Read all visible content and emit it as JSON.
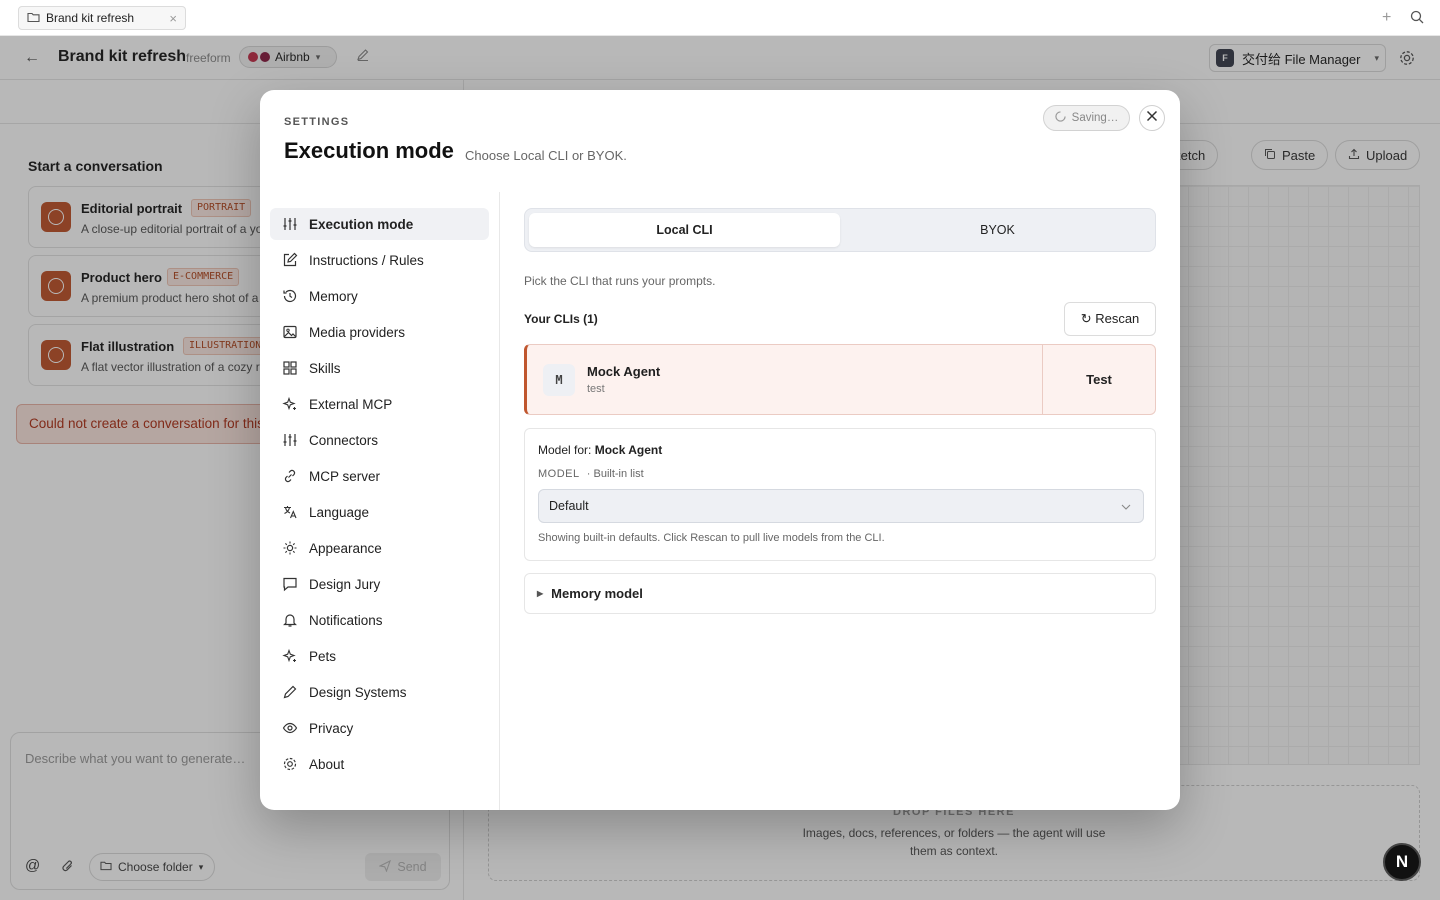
{
  "browser": {
    "tab_title": "Brand kit refresh",
    "tab_close": "×",
    "new_tab": "+"
  },
  "header": {
    "back": "←",
    "title": "Brand kit refresh",
    "mode": "freeform",
    "brand": "Airbnb",
    "brand_colors": [
      "#c2334d",
      "#8b2146"
    ],
    "file_manager_badge": "F",
    "file_manager": "交付给 File Manager"
  },
  "chat": {
    "start_title": "Start a conversation",
    "cards": [
      {
        "title": "Editorial portrait",
        "tag": "PORTRAIT",
        "desc": "A close-up editorial portrait of a young woman in soft window light"
      },
      {
        "title": "Product hero",
        "tag": "E-COMMERCE",
        "desc": "A premium product hero shot of a ceramic mug on a marble surface"
      },
      {
        "title": "Flat illustration",
        "tag": "ILLUSTRATION",
        "desc": "A flat vector illustration of a cozy reading nook with plants"
      }
    ],
    "error": "Could not create a conversation for this project.",
    "composer_placeholder": "Describe what you want to generate…",
    "mention": "@",
    "choose_folder": "Choose folder",
    "send": "Send"
  },
  "canvas": {
    "buttons": {
      "sketch": "New sketch",
      "paste": "Paste",
      "upload": "Upload"
    },
    "drop_title": "DROP FILES HERE",
    "drop_text": "Images, docs, references, or folders — the agent will use them as context.",
    "fab": "N"
  },
  "settings": {
    "kicker": "SETTINGS",
    "title": "Execution mode",
    "subtitle": "Choose Local CLI or BYOK.",
    "saving": "Saving…",
    "nav": [
      {
        "label": "Execution mode",
        "icon": "sliders-icon"
      },
      {
        "label": "Instructions / Rules",
        "icon": "pencil-square-icon"
      },
      {
        "label": "Memory",
        "icon": "history-icon"
      },
      {
        "label": "Media providers",
        "icon": "image-icon"
      },
      {
        "label": "Skills",
        "icon": "grid-icon"
      },
      {
        "label": "External MCP",
        "icon": "sparkle-icon"
      },
      {
        "label": "Connectors",
        "icon": "sliders-icon"
      },
      {
        "label": "MCP server",
        "icon": "link-icon"
      },
      {
        "label": "Language",
        "icon": "translate-icon"
      },
      {
        "label": "Appearance",
        "icon": "sun-icon"
      },
      {
        "label": "Design Jury",
        "icon": "chat-icon"
      },
      {
        "label": "Notifications",
        "icon": "bell-icon"
      },
      {
        "label": "Pets",
        "icon": "sparkle-icon"
      },
      {
        "label": "Design Systems",
        "icon": "pen-icon"
      },
      {
        "label": "Privacy",
        "icon": "eye-icon"
      },
      {
        "label": "About",
        "icon": "gear-icon"
      }
    ],
    "modes": {
      "local": "Local CLI",
      "byok": "BYOK",
      "selected": "Local CLI"
    },
    "hint": "Pick the CLI that runs your prompts.",
    "clis_title": "Your CLIs (1)",
    "rescan": "↻ Rescan",
    "agent": {
      "badge": "M",
      "name": "Mock Agent",
      "sub": "test",
      "test": "Test"
    },
    "model": {
      "title_prefix": "Model for:",
      "title_agent": "Mock Agent",
      "label": "MODEL",
      "source": "· Built-in list",
      "value": "Default",
      "note": "Showing built-in defaults. Click Rescan to pull live models from the CLI."
    },
    "memory_model": "Memory model"
  },
  "colors": {
    "accent": "#c0562e",
    "error_bg": "#fbe5df",
    "error_text": "#b0351c"
  }
}
